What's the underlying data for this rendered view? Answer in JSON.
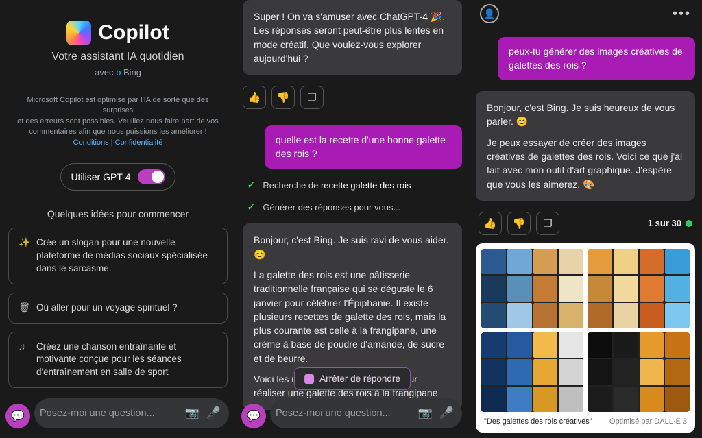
{
  "left": {
    "brand": "Copilot",
    "subtitle": "Votre assistant IA quotidien",
    "avec_prefix": "avec",
    "bing": "Bing",
    "disclaimer_line1": "Microsoft Copilot est optimisé par l'IA de sorte que des surprises",
    "disclaimer_line2": "et des erreurs sont possibles. Veuillez nous faire part de vos",
    "disclaimer_line3": "commentaires afin que nous puissions les améliorer !",
    "terms": "Conditions",
    "sep": " | ",
    "privacy": "Confidentialité",
    "gpt_label": "Utiliser GPT-4",
    "ideas_title": "Quelques idées pour commencer",
    "cards": [
      "Crée un slogan pour une nouvelle plateforme de médias sociaux spécialisée dans le sarcasme.",
      "Où aller pour un voyage spirituel ?",
      "Créez une chanson entraînante et motivante conçue pour les séances d'entraînement en salle de sport"
    ],
    "input_placeholder": "Posez-moi une question..."
  },
  "mid": {
    "ai_intro": "Super ! On va s'amuser avec ChatGPT-4 🎉. Les réponses seront peut-être plus lentes en mode créatif. Que voulez-vous explorer aujourd'hui ?",
    "user_msg": "quelle est la recette d'une bonne galette des rois ?",
    "status_search_prefix": "Recherche de ",
    "status_search_bold": "recette galette des rois",
    "status_gen": "Générer des réponses pour vous...",
    "ai_reply_p1": "Bonjour, c'est Bing. Je suis ravi de vous aider. 😊",
    "ai_reply_p2": "La galette des rois est une pâtisserie traditionnelle française qui se déguste le 6 janvier pour célébrer l'Épiphanie. Il existe plusieurs recettes de galette des rois, mais la plus courante est celle à la frangipane, une crème à base de poudre d'amande, de sucre et de beurre.",
    "ai_reply_p3": "Voici les ingrédients et les étapes pour réaliser une galette des rois à la frangipane",
    "stop_label": "Arrêter de répondre",
    "input_placeholder": "Posez-moi une question..."
  },
  "right": {
    "user_msg": "peux-tu générer des images créatives de galettes des rois ?",
    "ai_reply_p1": "Bonjour, c'est Bing. Je suis heureux de vous parler. 😊",
    "ai_reply_p2": "Je peux essayer de créer des images créatives de galettes des rois. Voici ce que j'ai fait avec mon outil d'art graphique. J'espère que vous les aimerez. 🎨",
    "counter": "1 sur 30",
    "image_caption": "\"Des galettes des rois créatives\"",
    "image_credit": "Optimisé par DALL·E 3"
  },
  "icons": {
    "like": "👍",
    "dislike": "👎",
    "copy": "❐",
    "camera": "📷",
    "mic": "🎤",
    "magic": "✨",
    "trash": "🗑",
    "music": "♫",
    "avatar": "👤",
    "dots": "•••",
    "chat": "💬"
  }
}
